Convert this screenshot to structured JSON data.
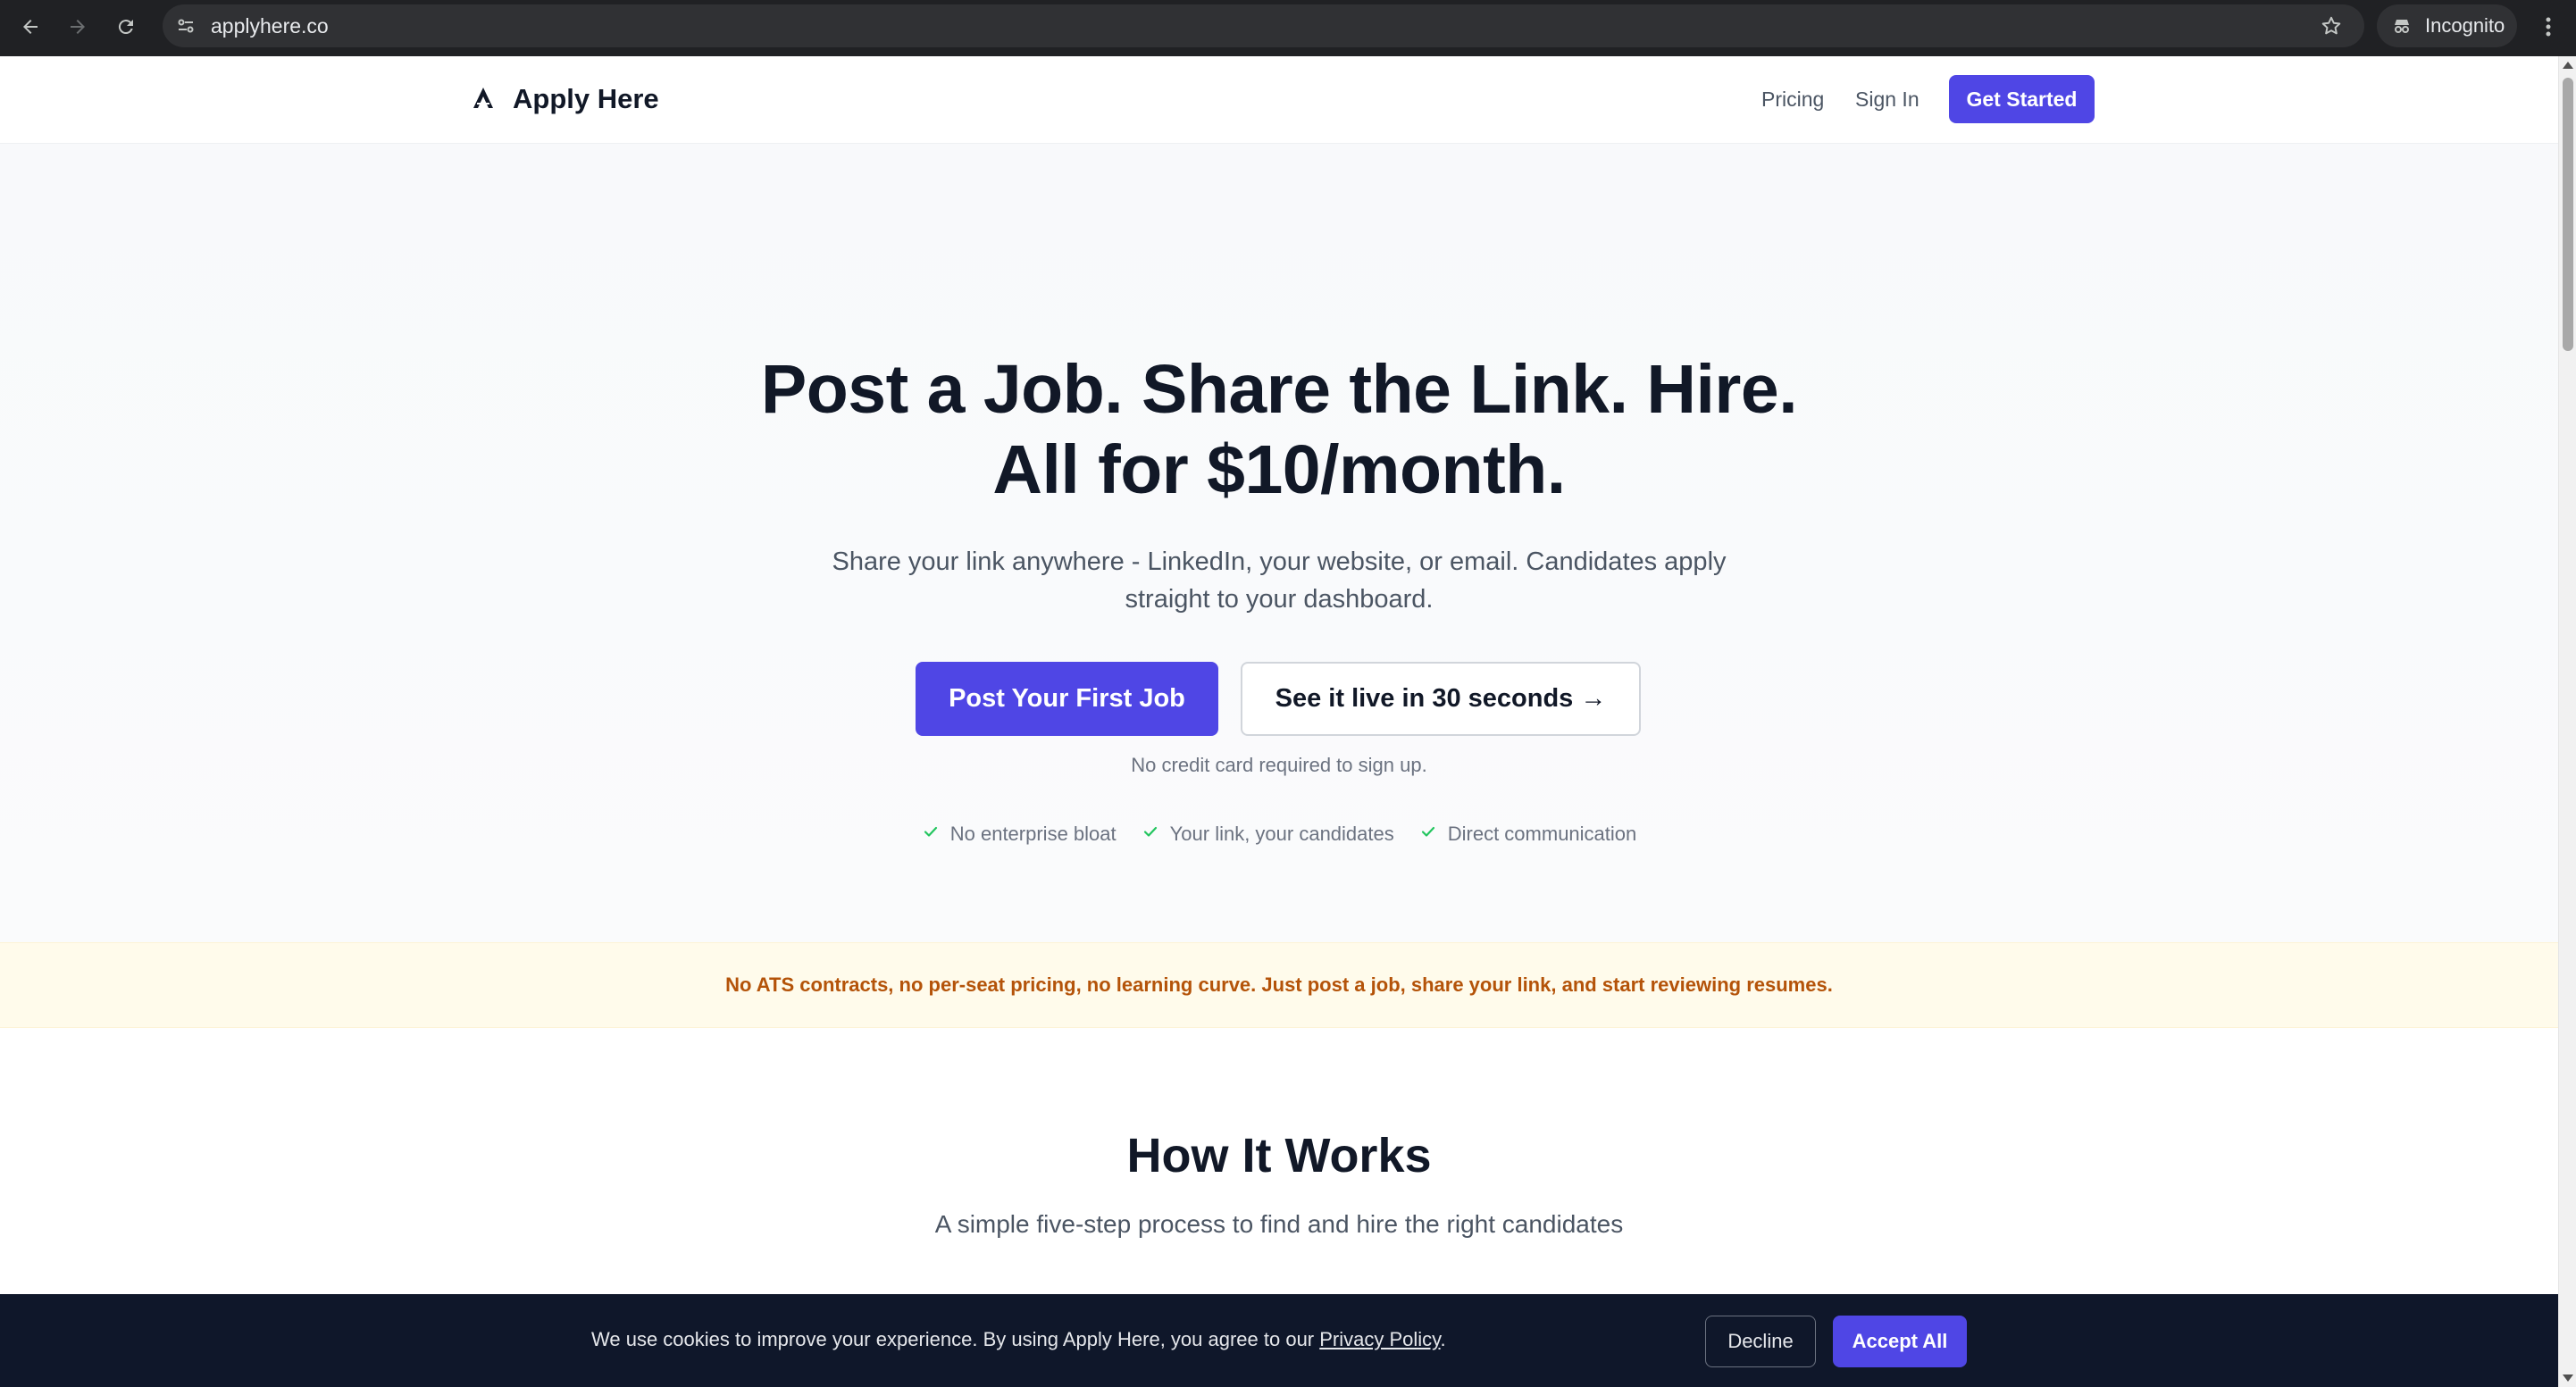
{
  "browser": {
    "url": "applyhere.co",
    "profile_label": "Incognito"
  },
  "header": {
    "brand": "Apply Here",
    "nav": {
      "pricing": "Pricing",
      "sign_in": "Sign In",
      "get_started": "Get Started"
    }
  },
  "hero": {
    "title_line1": "Post a Job. Share the Link. Hire.",
    "title_line2": "All for $10/month.",
    "subtitle": "Share your link anywhere - LinkedIn, your website, or email. Candidates apply straight to your dashboard.",
    "primary_cta": "Post Your First Job",
    "secondary_cta": "See it live in 30 seconds →",
    "note": "No credit card required to sign up.",
    "features": [
      "No enterprise bloat",
      "Your link, your candidates",
      "Direct communication"
    ]
  },
  "banner": {
    "text": "No ATS contracts, no per-seat pricing, no learning curve. Just post a job, share your link, and start reviewing resumes."
  },
  "how_it_works": {
    "title": "How It Works",
    "subtitle": "A simple five-step process to find and hire the right candidates"
  },
  "cookie": {
    "message_before": "We use cookies to improve your experience. By using Apply Here, you agree to our ",
    "link": "Privacy Policy",
    "message_after": ".",
    "decline": "Decline",
    "accept": "Accept All"
  },
  "colors": {
    "brand": "#4f46e5",
    "banner_text": "#b45309",
    "banner_bg": "#fffbeb",
    "check": "#22c55e",
    "cookie_bg": "#0f172a"
  },
  "icons": [
    "back-arrow-icon",
    "forward-arrow-icon",
    "reload-icon",
    "site-info-icon",
    "bookmark-star-icon",
    "incognito-icon",
    "more-menu-icon",
    "brand-logo-icon",
    "check-icon"
  ]
}
